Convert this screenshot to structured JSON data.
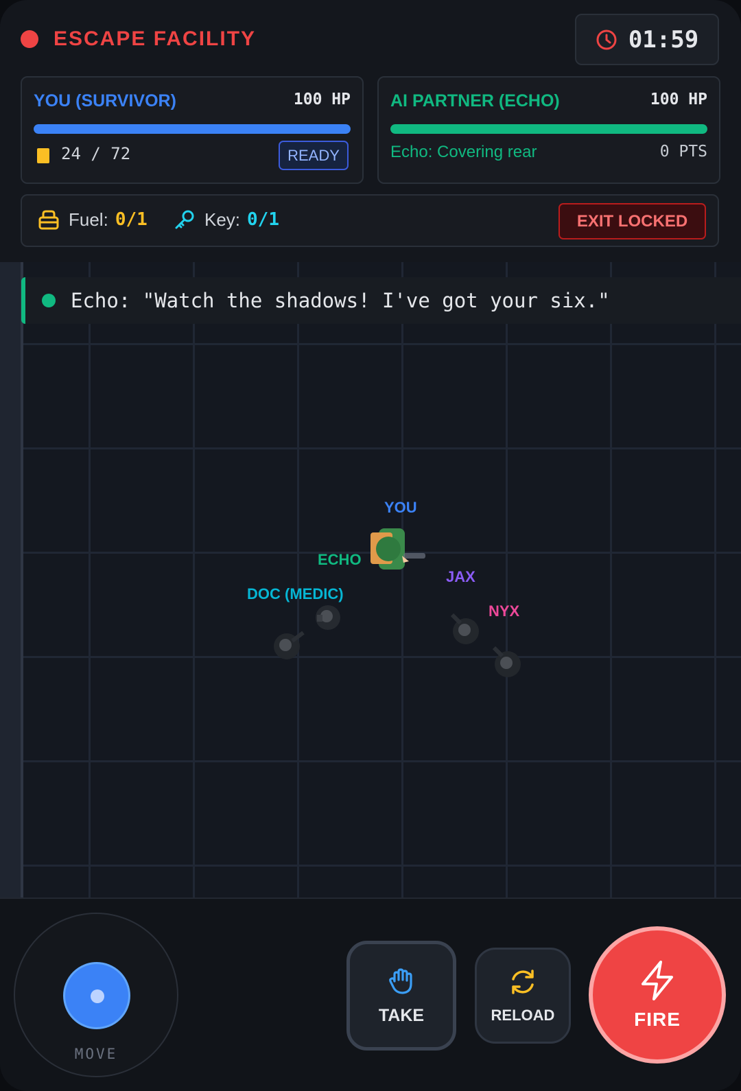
{
  "header": {
    "title": "ESCAPE FACILITY",
    "timer": "01:59"
  },
  "player": {
    "name": "YOU (SURVIVOR)",
    "hp": "100 HP",
    "health_fraction": 1.0,
    "health_color": "#3b82f6",
    "ammo": "24 / 72",
    "status": "READY"
  },
  "partner": {
    "name": "AI PARTNER (ECHO)",
    "hp": "100 HP",
    "health_fraction": 1.0,
    "health_color": "#10b981",
    "status": "Echo: Covering rear",
    "points": "0 PTS"
  },
  "objectives": {
    "fuel_label": "Fuel:",
    "fuel_value": "0/1",
    "key_label": "Key:",
    "key_value": "0/1",
    "exit_status": "EXIT LOCKED"
  },
  "chat": {
    "message": "Echo: \"Watch the shadows! I've got your six.\""
  },
  "arena": {
    "labels": {
      "you": "YOU",
      "echo": "ECHO",
      "jax": "JAX",
      "nyx": "NYX",
      "doc": "DOC (MEDIC)"
    }
  },
  "controls": {
    "move": "MOVE",
    "take": "TAKE",
    "reload": "RELOAD",
    "fire": "FIRE"
  },
  "colors": {
    "accent_red": "#ef4444",
    "player_blue": "#3b82f6",
    "partner_green": "#10b981",
    "ammo_yellow": "#fbbf24",
    "key_cyan": "#22d3ee",
    "jax_purple": "#8b5cf6",
    "nyx_pink": "#ec4899",
    "doc_cyan": "#06b6d4"
  },
  "icons": [
    "clock-icon",
    "ammo-icon",
    "fuel-can-icon",
    "key-icon",
    "hand-icon",
    "reload-icon",
    "lightning-icon"
  ]
}
